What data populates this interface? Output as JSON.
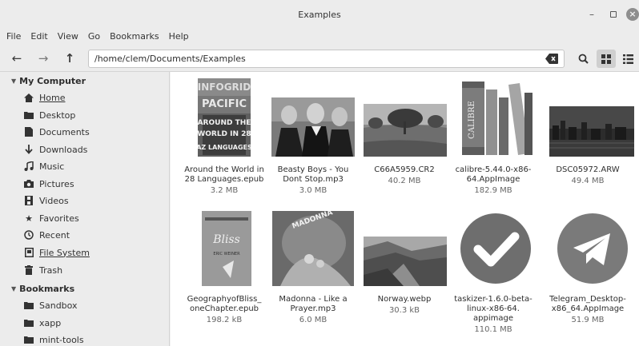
{
  "window": {
    "title": "Examples"
  },
  "menu": [
    "File",
    "Edit",
    "View",
    "Go",
    "Bookmarks",
    "Help"
  ],
  "location": {
    "path": "/home/clem/Documents/Examples"
  },
  "sidebar": {
    "sections": [
      {
        "label": "My Computer"
      },
      {
        "label": "Bookmarks"
      }
    ],
    "items": [
      {
        "label": "Home",
        "icon": "home-icon"
      },
      {
        "label": "Desktop",
        "icon": "folder-icon"
      },
      {
        "label": "Documents",
        "icon": "document-icon"
      },
      {
        "label": "Downloads",
        "icon": "download-icon"
      },
      {
        "label": "Music",
        "icon": "music-icon"
      },
      {
        "label": "Pictures",
        "icon": "camera-icon"
      },
      {
        "label": "Videos",
        "icon": "film-icon"
      },
      {
        "label": "Favorites",
        "icon": "star-icon"
      },
      {
        "label": "Recent",
        "icon": "clock-icon"
      },
      {
        "label": "File System",
        "icon": "drive-icon"
      },
      {
        "label": "Trash",
        "icon": "trash-icon"
      },
      {
        "label": "Sandbox",
        "icon": "folder-icon"
      },
      {
        "label": "xapp",
        "icon": "folder-icon"
      },
      {
        "label": "mint-tools",
        "icon": "folder-icon"
      }
    ]
  },
  "files": [
    {
      "name1": "Around the World in",
      "name2": "28 Languages.epub",
      "size": "3.2 MB",
      "kind": "book"
    },
    {
      "name1": "Beasty Boys - You",
      "name2": "Dont Stop.mp3",
      "size": "3.0 MB",
      "kind": "photo"
    },
    {
      "name1": "C66A5959.CR2",
      "name2": "",
      "size": "40.2 MB",
      "kind": "landscape"
    },
    {
      "name1": "calibre-5.44.0-x86-",
      "name2": "64.AppImage",
      "size": "182.9 MB",
      "kind": "calibre"
    },
    {
      "name1": "DSC05972.ARW",
      "name2": "",
      "size": "49.4 MB",
      "kind": "city"
    },
    {
      "name1": "GeographyofBliss_",
      "name2": "oneChapter.epub",
      "size": "198.2 kB",
      "kind": "bliss"
    },
    {
      "name1": "Madonna - Like a",
      "name2": "Prayer.mp3",
      "size": "6.0 MB",
      "kind": "madonna"
    },
    {
      "name1": "Norway.webp",
      "name2": "",
      "size": "30.3 kB",
      "kind": "norway"
    },
    {
      "name1": "taskizer-1.6.0-beta-",
      "name2": "linux-x86-64.",
      "name3": "appimage",
      "size": "110.1 MB",
      "kind": "check"
    },
    {
      "name1": "Telegram_Desktop-",
      "name2": "x86_64.AppImage",
      "size": "51.9 MB",
      "kind": "telegram"
    }
  ],
  "book_cover_text": [
    "INFOGRID",
    "PACIFIC",
    "AROUND THE",
    "WORLD IN 28",
    "AZ LANGUAGES"
  ],
  "bliss_cover_text": [
    "Bliss",
    "ERIC WEINER"
  ],
  "madonna_text": "MADONNA",
  "calibre_text": "CALIBRE"
}
